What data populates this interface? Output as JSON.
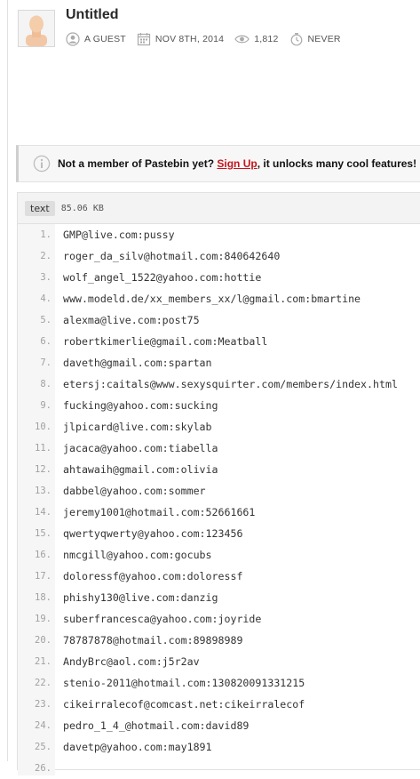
{
  "paste": {
    "title": "Untitled",
    "author": "A GUEST",
    "date": "NOV 8TH, 2014",
    "views": "1,812",
    "expires": "NEVER"
  },
  "notice": {
    "lead": "Not a member of Pastebin yet?",
    "link": "Sign Up",
    "rest": ", it unlocks many cool features!"
  },
  "code": {
    "syntax": "text",
    "size": "85.06 KB",
    "lines": [
      {
        "n": "1.",
        "text": "GMP@live.com:pussy"
      },
      {
        "n": "2.",
        "text": "roger_da_silv@hotmail.com:840642640"
      },
      {
        "n": "3.",
        "text": "wolf_angel_1522@yahoo.com:hottie"
      },
      {
        "n": "4.",
        "text": "www.modeld.de/xx_members_xx/l@gmail.com:bmartine"
      },
      {
        "n": "5.",
        "text": "alexma@live.com:post75"
      },
      {
        "n": "6.",
        "text": "robertkimerlie@gmail.com:Meatball"
      },
      {
        "n": "7.",
        "text": "daveth@gmail.com:spartan"
      },
      {
        "n": "8.",
        "text": "etersj:caitals@www.sexysquirter.com/members/index.html"
      },
      {
        "n": "9.",
        "text": "fucking@yahoo.com:sucking"
      },
      {
        "n": "10.",
        "text": "jlpicard@live.com:skylab"
      },
      {
        "n": "11.",
        "text": "jacaca@yahoo.com:tiabella"
      },
      {
        "n": "12.",
        "text": "ahtawaih@gmail.com:olivia"
      },
      {
        "n": "13.",
        "text": "dabbel@yahoo.com:sommer"
      },
      {
        "n": "14.",
        "text": "jeremy1001@hotmail.com:52661661"
      },
      {
        "n": "15.",
        "text": "qwertyqwerty@yahoo.com:123456"
      },
      {
        "n": "16.",
        "text": "nmcgill@yahoo.com:gocubs"
      },
      {
        "n": "17.",
        "text": "doloressf@yahoo.com:doloressf"
      },
      {
        "n": "18.",
        "text": "phishy130@live.com:danzig"
      },
      {
        "n": "19.",
        "text": "suberfrancesca@yahoo.com:joyride"
      },
      {
        "n": "20.",
        "text": "78787878@hotmail.com:89898989"
      },
      {
        "n": "21.",
        "text": "AndyBrc@aol.com:j5r2av"
      },
      {
        "n": "22.",
        "text": "stenio-2011@hotmail.com:130820091331215"
      },
      {
        "n": "23.",
        "text": "cikeirralecof@comcast.net:cikeirralecof"
      },
      {
        "n": "24.",
        "text": "pedro_1_4_@hotmail.com:david89"
      },
      {
        "n": "25.",
        "text": "davetp@yahoo.com:may1891"
      },
      {
        "n": "26.",
        "text": ""
      }
    ]
  },
  "icons": {
    "author": "user-icon",
    "date": "calendar-icon",
    "views": "eye-icon",
    "expires": "stopwatch-icon",
    "notice": "info-icon"
  },
  "colors": {
    "signup_link": "#c4161c",
    "line_number": "#a0a0a0",
    "code_text": "#333333"
  }
}
